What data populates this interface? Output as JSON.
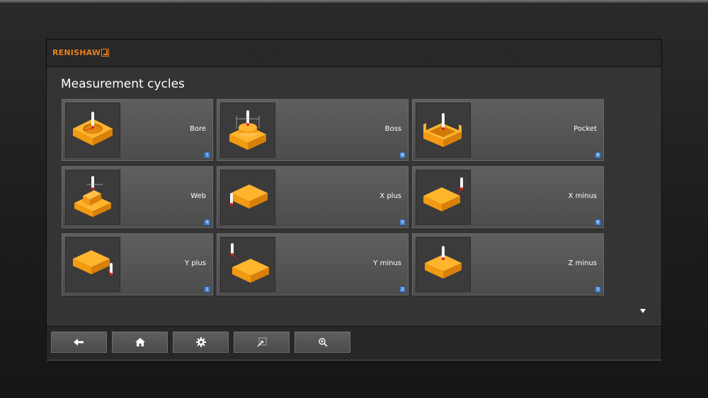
{
  "brand": {
    "logo_text": "RENISHAW"
  },
  "page": {
    "title": "Measurement cycles"
  },
  "tiles": [
    {
      "label": "Bore",
      "shortcut": "7",
      "icon": "bore-icon"
    },
    {
      "label": "Boss",
      "shortcut": "8",
      "icon": "boss-icon"
    },
    {
      "label": "Pocket",
      "shortcut": "9",
      "icon": "pocket-icon"
    },
    {
      "label": "Web",
      "shortcut": "4",
      "icon": "web-icon"
    },
    {
      "label": "X plus",
      "shortcut": "5",
      "icon": "x-plus-icon"
    },
    {
      "label": "X minus",
      "shortcut": "6",
      "icon": "x-minus-icon"
    },
    {
      "label": "Y plus",
      "shortcut": "1",
      "icon": "y-plus-icon"
    },
    {
      "label": "Y minus",
      "shortcut": "2",
      "icon": "y-minus-icon"
    },
    {
      "label": "Z minus",
      "shortcut": "3",
      "icon": "z-minus-icon"
    }
  ],
  "nav": {
    "buttons": [
      {
        "icon": "back-arrow-icon"
      },
      {
        "icon": "home-icon"
      },
      {
        "icon": "gear-icon"
      },
      {
        "icon": "resize-icon"
      },
      {
        "icon": "probe-search-icon"
      }
    ]
  },
  "colors": {
    "accent": "#e8801a",
    "block": "#f5a21b",
    "shortcut_badge": "#4a86c8"
  }
}
